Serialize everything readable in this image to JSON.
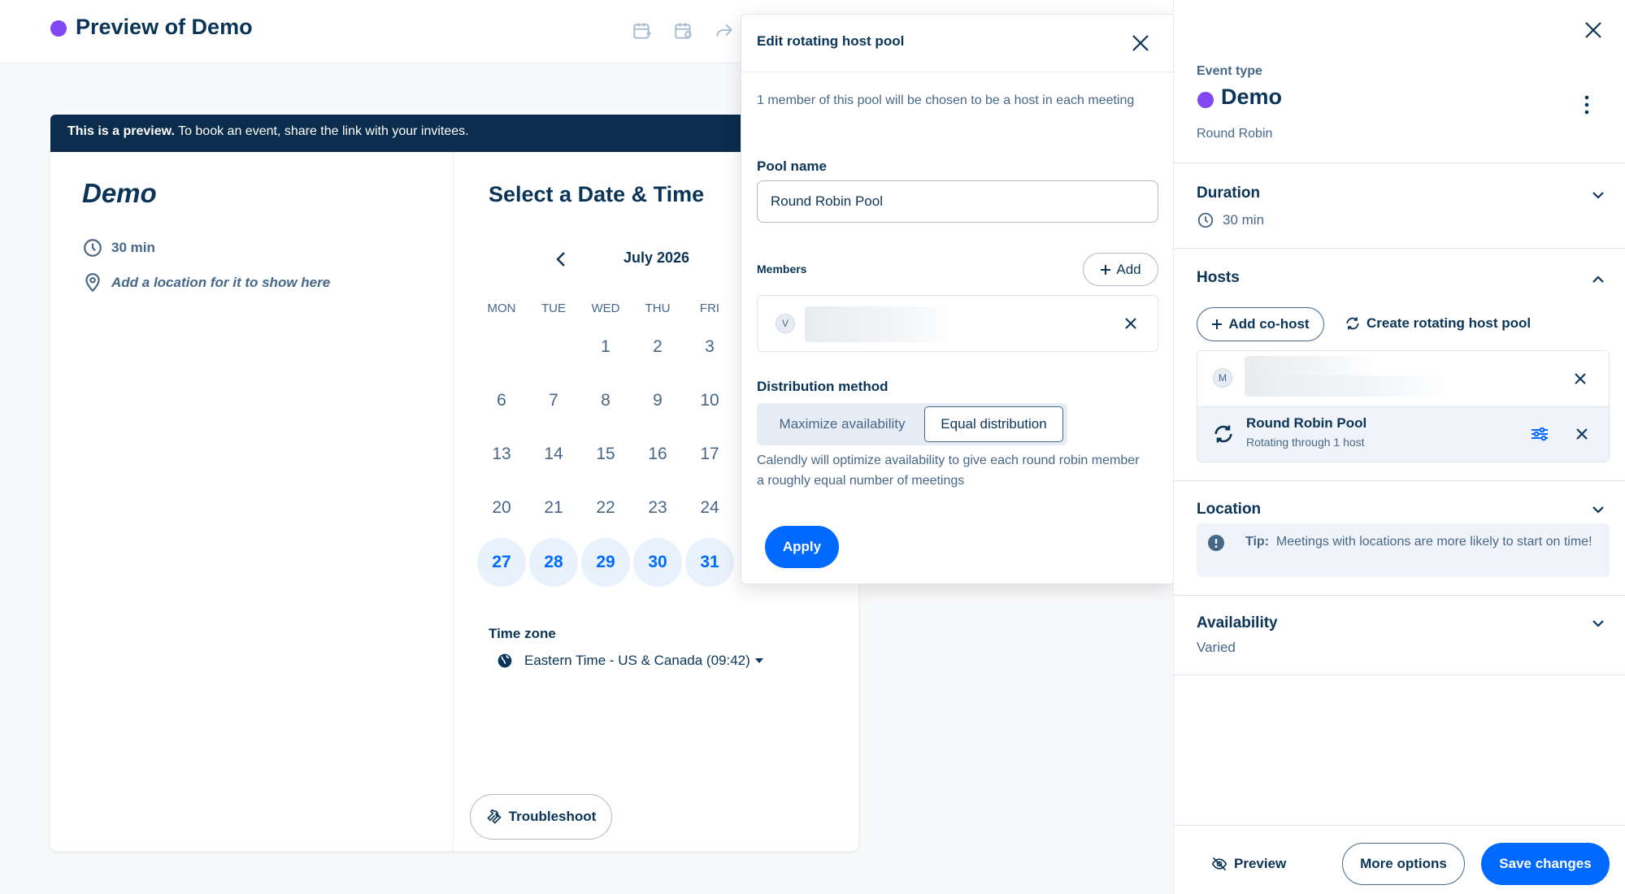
{
  "header": {
    "title": "Preview of Demo",
    "dot_color": "#8247f5"
  },
  "preview": {
    "banner_bold": "This is a preview.",
    "banner_text": " To book an event, share the link with your invitees.",
    "event_name": "Demo",
    "duration": "30 min",
    "location_hint": "Add a location for it to show here",
    "select_title": "Select a Date & Time",
    "month": "July 2026",
    "weekdays": [
      "MON",
      "TUE",
      "WED",
      "THU",
      "FRI"
    ],
    "weeks": [
      [
        null,
        null,
        "1",
        "2",
        "3"
      ],
      [
        "6",
        "7",
        "8",
        "9",
        "10"
      ],
      [
        "13",
        "14",
        "15",
        "16",
        "17"
      ],
      [
        "20",
        "21",
        "22",
        "23",
        "24"
      ],
      [
        "27",
        "28",
        "29",
        "30",
        "31"
      ]
    ],
    "available_days": [
      "27",
      "28",
      "29",
      "30",
      "31"
    ],
    "timezone_label": "Time zone",
    "timezone_value": "Eastern Time - US & Canada (09:42)",
    "troubleshoot": "Troubleshoot"
  },
  "modal": {
    "title": "Edit rotating host pool",
    "description": "1 member of this pool will be chosen to be a host in each meeting",
    "pool_name_label": "Pool name",
    "pool_name_value": "Round Robin Pool",
    "members_label": "Members",
    "add_label": "Add",
    "member_initial": "V",
    "distribution_label": "Distribution method",
    "distribution_options": [
      "Maximize availability",
      "Equal distribution"
    ],
    "distribution_selected": "Equal distribution",
    "distribution_desc": "Calendly will optimize availability to give each round robin member a roughly equal number of meetings",
    "apply": "Apply"
  },
  "panel": {
    "event_type_label": "Event type",
    "event_name": "Demo",
    "event_kind": "Round Robin",
    "duration_title": "Duration",
    "duration_value": "30 min",
    "hosts_title": "Hosts",
    "add_cohost": "Add co-host",
    "create_pool": "Create rotating host pool",
    "host_initial": "M",
    "pool_name": "Round Robin Pool",
    "pool_sub": "Rotating through 1 host",
    "location_title": "Location",
    "tip_bold": "Tip:",
    "tip_text": "Meetings with locations are more likely to start on time!",
    "availability_title": "Availability",
    "availability_value": "Varied",
    "preview": "Preview",
    "more_options": "More options",
    "save": "Save changes"
  },
  "colors": {
    "brand_blue": "#0069ff",
    "navy": "#0b3558",
    "purple": "#8247f5",
    "banner": "#0b2d4d"
  }
}
